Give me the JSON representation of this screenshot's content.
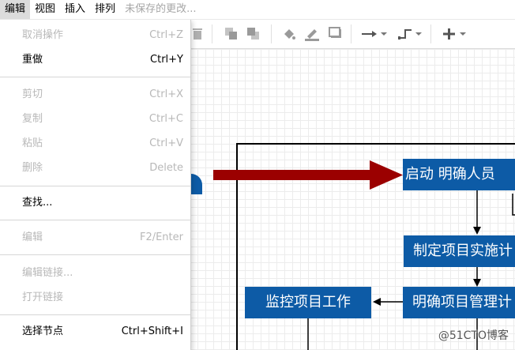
{
  "menubar": {
    "items": [
      "编辑",
      "视图",
      "插入",
      "排列"
    ],
    "unsaved": "未保存的更改..."
  },
  "toolbar": {
    "icons": [
      "delete-icon",
      "to-front-icon",
      "to-back-icon",
      "fill-color-icon",
      "line-color-icon",
      "shadow-icon",
      "connection-arrow-icon",
      "waypoints-icon",
      "insert-plus-icon"
    ]
  },
  "edit_menu": {
    "undo": {
      "label": "取消操作",
      "shortcut": "Ctrl+Z"
    },
    "redo": {
      "label": "重做",
      "shortcut": "Ctrl+Y"
    },
    "cut": {
      "label": "剪切",
      "shortcut": "Ctrl+X"
    },
    "copy": {
      "label": "复制",
      "shortcut": "Ctrl+C"
    },
    "paste": {
      "label": "粘贴",
      "shortcut": "Ctrl+V"
    },
    "delete": {
      "label": "删除",
      "shortcut": "Delete"
    },
    "find": {
      "label": "查找..."
    },
    "edit": {
      "label": "编辑",
      "shortcut": "F2/Enter"
    },
    "edit_link": {
      "label": "编辑链接..."
    },
    "open_link": {
      "label": "打开链接"
    },
    "select_vertices": {
      "label": "选择节点",
      "shortcut": "Ctrl+Shift+I"
    }
  },
  "diagram": {
    "box_start": "启动  明确人员",
    "box_plan": "制定项目实施计",
    "box_manage": "明确项目管理计",
    "box_monitor": "监控项目工作"
  },
  "colors": {
    "box_fill": "#0d5ba6",
    "big_arrow": "#9b0000",
    "pointer_arrow": "#e8261c"
  },
  "watermark": "@51CTO博客"
}
